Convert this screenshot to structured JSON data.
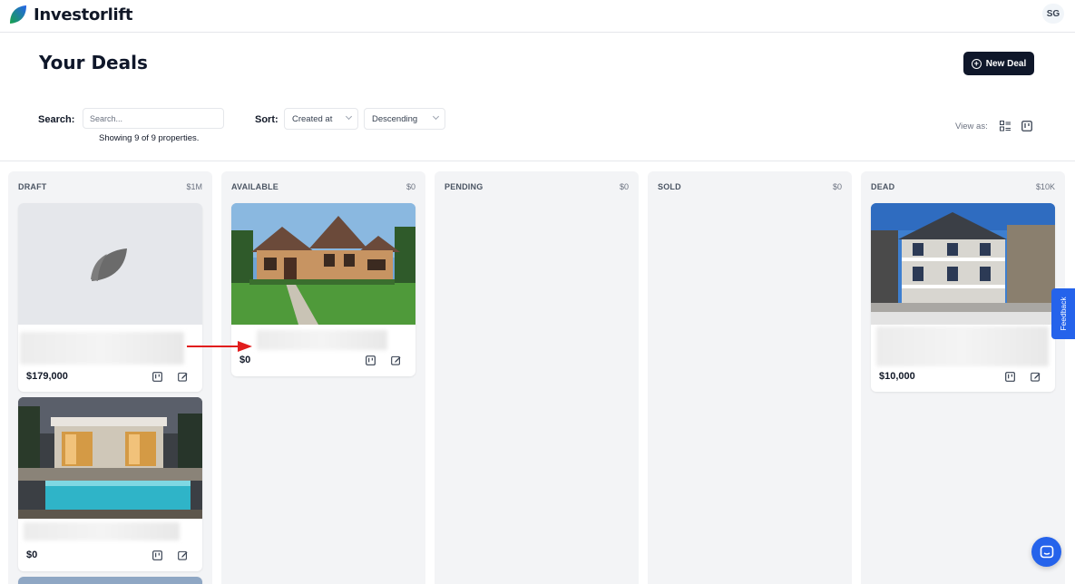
{
  "app": {
    "name": "Investorlift",
    "user_initials": "SG"
  },
  "page": {
    "title": "Your Deals",
    "new_deal_label": "New Deal"
  },
  "filters": {
    "search_label": "Search:",
    "search_placeholder": "Search...",
    "search_value": "",
    "showing_text": "Showing 9 of 9 properties.",
    "sort_label": "Sort:",
    "sort_field": "Created at",
    "sort_order": "Descending",
    "view_as_label": "View as:"
  },
  "columns": [
    {
      "title": "DRAFT",
      "total": "$1M",
      "cards": [
        {
          "price": "$179,000",
          "image": "logo-placeholder"
        },
        {
          "price": "$0",
          "image": "modern-house-pool"
        }
      ]
    },
    {
      "title": "AVAILABLE",
      "total": "$0",
      "cards": [
        {
          "price": "$0",
          "image": "stone-house-lawn"
        }
      ]
    },
    {
      "title": "PENDING",
      "total": "$0",
      "cards": []
    },
    {
      "title": "SOLD",
      "total": "$0",
      "cards": []
    },
    {
      "title": "DEAD",
      "total": "$10K",
      "cards": [
        {
          "price": "$10,000",
          "image": "old-duplex-house"
        }
      ]
    }
  ],
  "widgets": {
    "feedback_label": "Feedback"
  },
  "colors": {
    "primary_dark": "#0f172a",
    "accent_blue": "#2563eb",
    "annotation_arrow": "#e11d1d",
    "column_bg": "#f3f4f6"
  }
}
